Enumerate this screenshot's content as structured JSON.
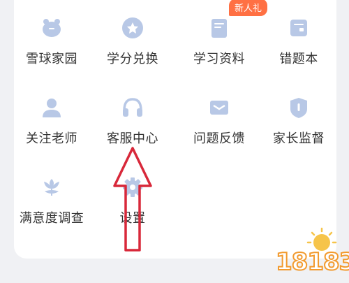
{
  "menu": {
    "items": [
      {
        "label": "雪球家园",
        "icon": "piggy-bank-icon"
      },
      {
        "label": "学分兑换",
        "icon": "star-coin-icon"
      },
      {
        "label": "学习资料",
        "icon": "book-icon",
        "badge": "新人礼"
      },
      {
        "label": "错题本",
        "icon": "notebook-icon"
      },
      {
        "label": "关注老师",
        "icon": "person-icon"
      },
      {
        "label": "客服中心",
        "icon": "headset-icon"
      },
      {
        "label": "问题反馈",
        "icon": "mail-icon"
      },
      {
        "label": "家长监督",
        "icon": "shield-icon"
      },
      {
        "label": "满意度调查",
        "icon": "flower-icon"
      },
      {
        "label": "设置",
        "icon": "gear-icon"
      }
    ]
  },
  "colors": {
    "icon": "#b8c8e6",
    "label": "#333333",
    "badge": "#ff7043",
    "arrow": "#d8283a",
    "background": "#f0f1f4",
    "card": "#ffffff"
  },
  "watermark": {
    "text": "18183"
  }
}
